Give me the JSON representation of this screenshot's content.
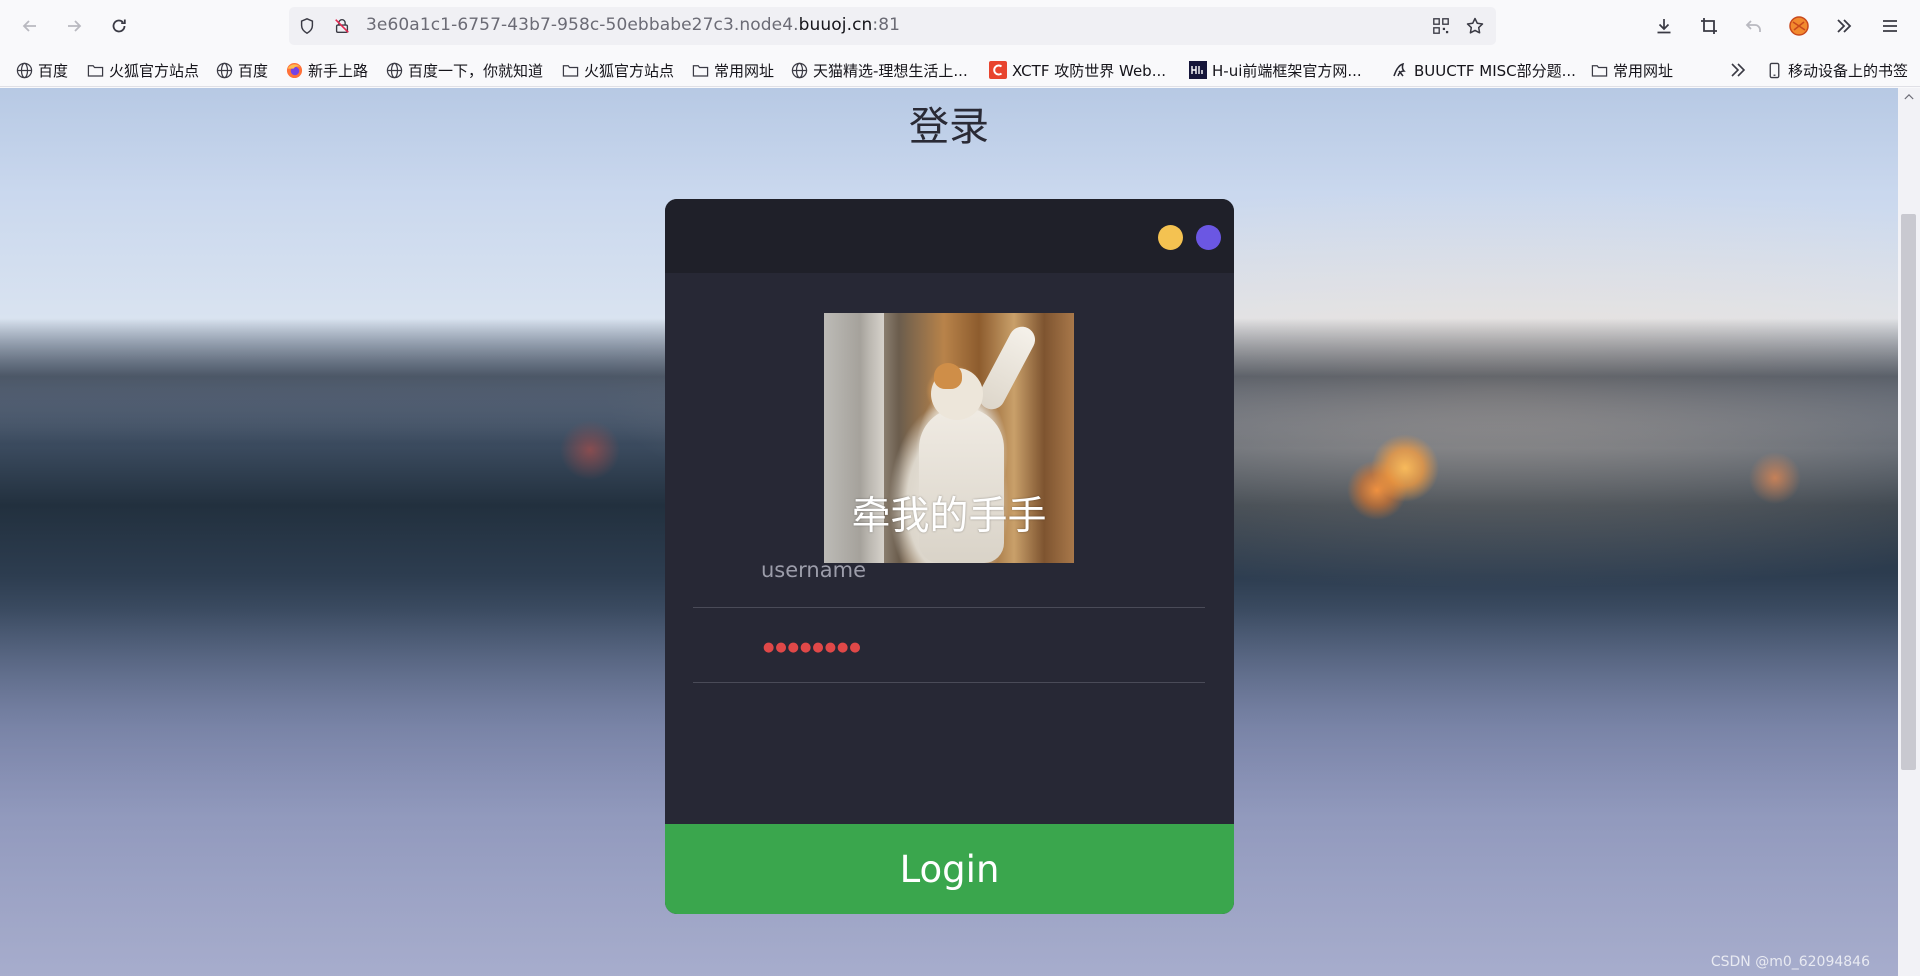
{
  "browser": {
    "url_prefix": "3e60a1c1-6757-43b7-958c-50ebbabe27c3.node4.",
    "url_host": "buuoj.cn",
    "url_suffix": ":81"
  },
  "bookmarks": [
    {
      "label": "百度",
      "icon": "globe-icon"
    },
    {
      "label": "火狐官方站点",
      "icon": "folder-icon"
    },
    {
      "label": "百度",
      "icon": "globe-icon"
    },
    {
      "label": "新手上路",
      "icon": "firefox-icon"
    },
    {
      "label": "百度一下，你就知道",
      "icon": "globe-icon"
    },
    {
      "label": "火狐官方站点",
      "icon": "folder-icon"
    },
    {
      "label": "常用网址",
      "icon": "folder-icon"
    },
    {
      "label": "天猫精选-理想生活上...",
      "icon": "globe-icon"
    },
    {
      "label": "XCTF 攻防世界 Web...",
      "icon": "xctf-icon"
    },
    {
      "label": "H-ui前端框架官方网...",
      "icon": "hui-icon"
    },
    {
      "label": "BUUCTF MISC部分题...",
      "icon": "buuctf-icon"
    },
    {
      "label": "常用网址",
      "icon": "folder-icon"
    }
  ],
  "bookmarks_more": "移动设备上的书签",
  "page": {
    "title": "登录",
    "meme_caption": "牵我的手手",
    "username_placeholder": "username",
    "password_dots": "●●●●●●●●",
    "login_label": "Login",
    "watermark": "CSDN @m0_62094846"
  },
  "colors": {
    "card_bg": "#272835",
    "card_header": "#1f2029",
    "dot_yellow": "#f4c251",
    "dot_purple": "#6b57e3",
    "login_green": "#3aa64d",
    "password_dots": "#e04848"
  }
}
